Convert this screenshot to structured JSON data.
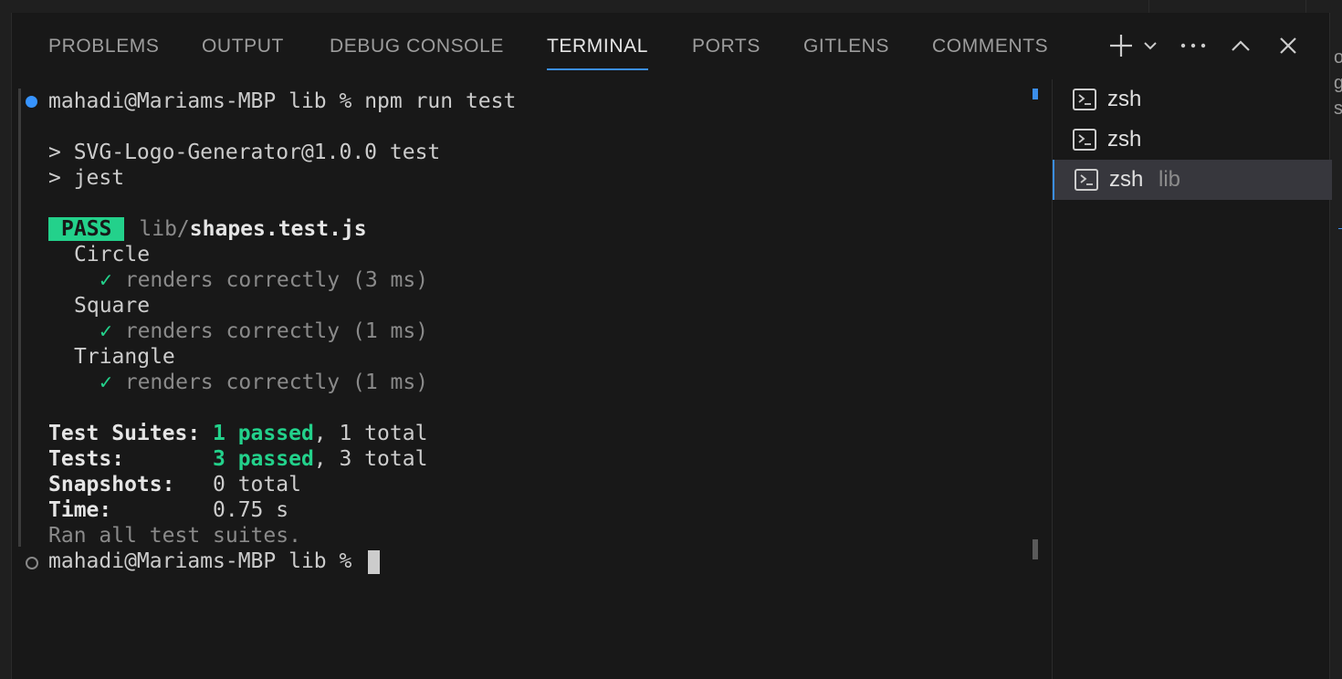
{
  "tabs": [
    "PROBLEMS",
    "OUTPUT",
    "DEBUG CONSOLE",
    "TERMINAL",
    "PORTS",
    "GITLENS",
    "COMMENTS"
  ],
  "active_tab": "TERMINAL",
  "terminal": {
    "prompt": "mahadi@Mariams-MBP lib % ",
    "command": "npm run test",
    "script_line": "> SVG-Logo-Generator@1.0.0 test",
    "jest_line": "> jest",
    "pass_badge": "PASS",
    "test_path_dir": "lib/",
    "test_path_file": "shapes.test.js",
    "suites": [
      {
        "name": "Circle",
        "result": "renders correctly (3 ms)"
      },
      {
        "name": "Square",
        "result": "renders correctly (1 ms)"
      },
      {
        "name": "Triangle",
        "result": "renders correctly (1 ms)"
      }
    ],
    "check": "✓",
    "summary": {
      "suites_label": "Test Suites: ",
      "suites_passed": "1 passed",
      "suites_total": ", 1 total",
      "tests_label": "Tests:       ",
      "tests_passed": "3 passed",
      "tests_total": ", 3 total",
      "snapshots_label": "Snapshots:   ",
      "snapshots_value": "0 total",
      "time_label": "Time:        ",
      "time_value": "0.75 s",
      "ran_all": "Ran all test suites."
    },
    "final_prompt": "mahadi@Mariams-MBP lib % "
  },
  "sessions": [
    {
      "name": "zsh",
      "sub": "",
      "selected": false
    },
    {
      "name": "zsh",
      "sub": "",
      "selected": false
    },
    {
      "name": "zsh",
      "sub": "lib",
      "selected": true
    }
  ],
  "icons": {
    "new_terminal": "plus-icon",
    "dropdown": "chevron-down-icon",
    "more": "ellipsis-icon",
    "maximize": "chevron-up-icon",
    "close": "close-icon",
    "session": "terminal-icon"
  },
  "colors": {
    "accent": "#3b8eea",
    "pass_green": "#23d18b"
  }
}
